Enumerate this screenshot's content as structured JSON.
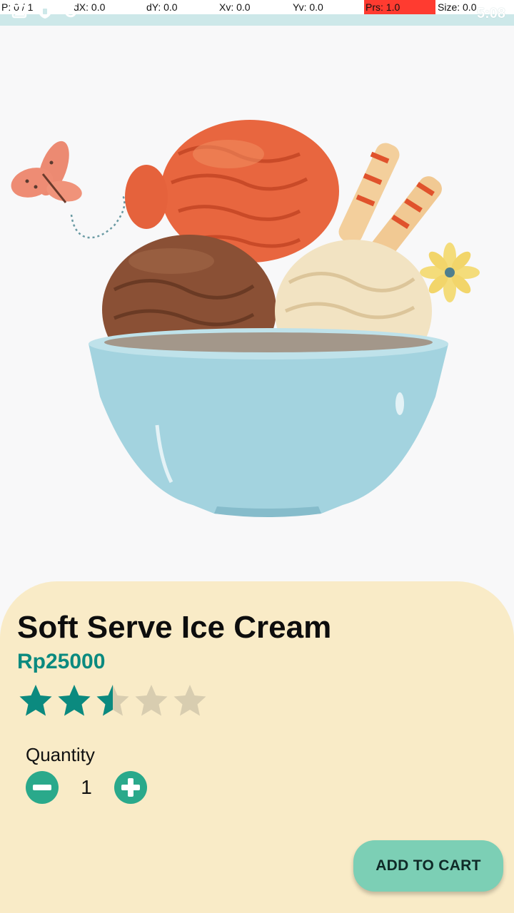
{
  "debug": {
    "pointer": "P: 0 / 1",
    "dx": "dX: 0.0",
    "dy": "dY: 0.0",
    "xv": "Xv: 0.0",
    "yv": "Yv: 0.0",
    "prs": "Prs: 1.0",
    "size": "Size: 0.0"
  },
  "status": {
    "clock": "5:08",
    "icons": [
      "image-icon",
      "shield-icon",
      "sync-icon"
    ]
  },
  "hero": {
    "image": "ice-cream-bowl-image"
  },
  "product": {
    "name": "Soft Serve Ice Cream",
    "price": "Rp25000",
    "rating": 2.5,
    "rating_max": 5
  },
  "quantity": {
    "label": "Quantity",
    "value": "1"
  },
  "actions": {
    "add_to_cart": "ADD TO CART"
  },
  "colors": {
    "accent": "#0b8a7f",
    "sheet": "#f9ebc7",
    "button": "#7ccfb5",
    "star_off": "#d8cdb0"
  }
}
